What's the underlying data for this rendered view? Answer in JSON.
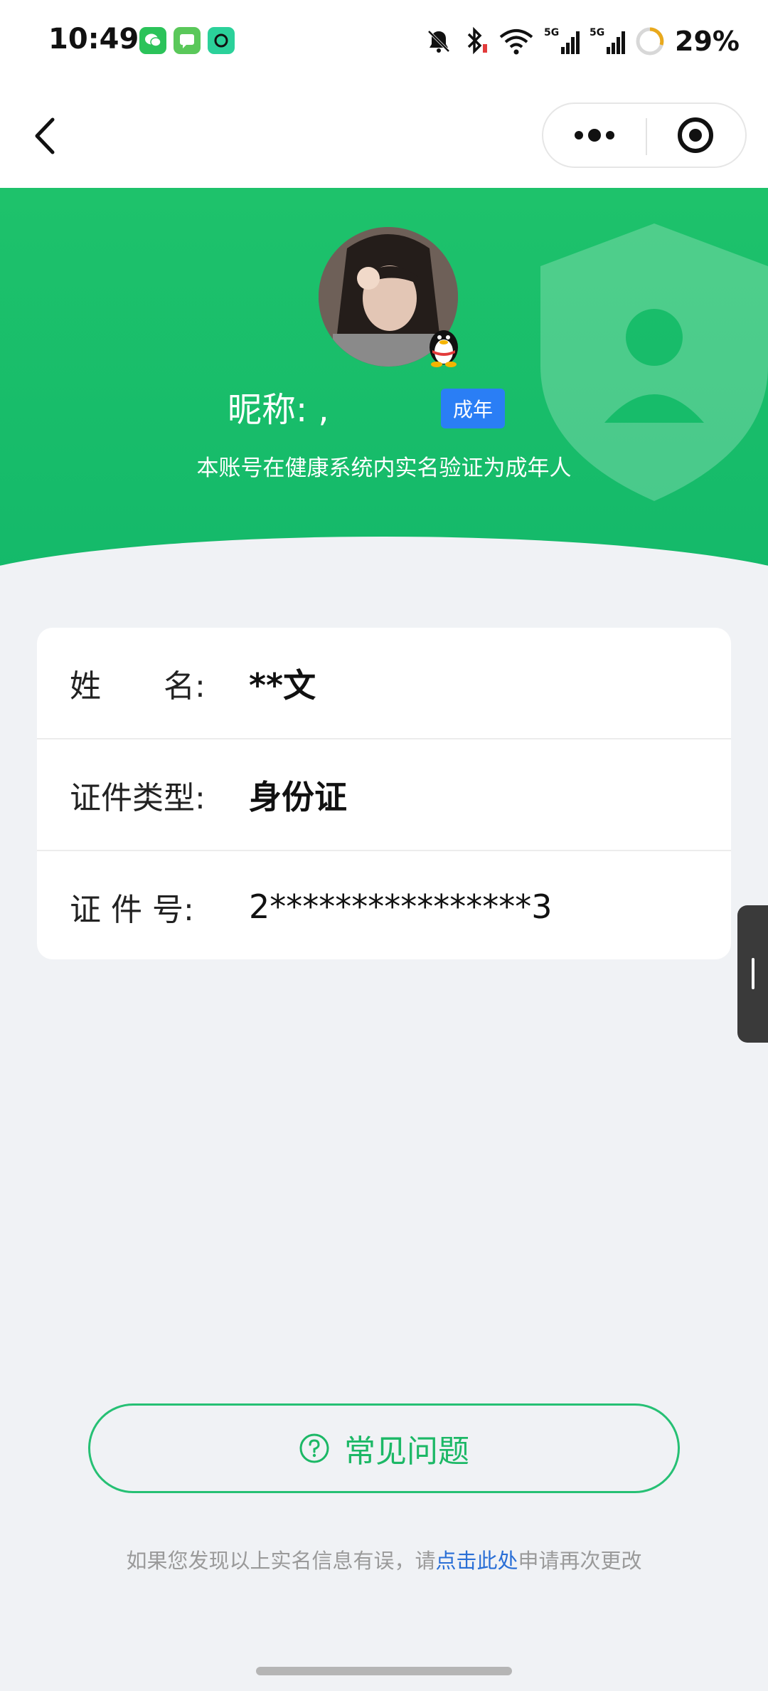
{
  "status_bar": {
    "time": "10:49",
    "battery": "29%",
    "icons": [
      "wechat-icon",
      "messages-icon",
      "app-icon",
      "mute-bell-icon",
      "bluetooth-icon",
      "wifi-icon",
      "5g-signal-icon",
      "5g-signal-icon",
      "battery-ring-icon"
    ]
  },
  "nav": {
    "back_icon": "chevron-left-icon",
    "more_icon": "more-dots-icon",
    "close_icon": "target-close-icon"
  },
  "profile": {
    "nickname": "昵称:    ,",
    "adult_tag": "成年",
    "subtitle": "本账号在健康系统内实名验证为成年人",
    "avatar_icon": "avatar-photo",
    "qq_icon": "qq-penguin-icon"
  },
  "info": {
    "rows": [
      {
        "label": "姓　　名:",
        "value": "**文"
      },
      {
        "label": "证件类型:",
        "value": "身份证"
      },
      {
        "label": "证 件 号:",
        "value": "2****************3"
      }
    ]
  },
  "faq": {
    "label": "常见问题",
    "icon": "question-circle-icon"
  },
  "footer": {
    "prefix": "如果您发现以上实名信息有误，请",
    "link": "点击此处",
    "suffix": "申请再次更改"
  },
  "colors": {
    "brand_green": "#1ec26b",
    "tag_blue": "#2a7ef5",
    "link_blue": "#2a6fd6",
    "background": "#f0f2f5"
  }
}
